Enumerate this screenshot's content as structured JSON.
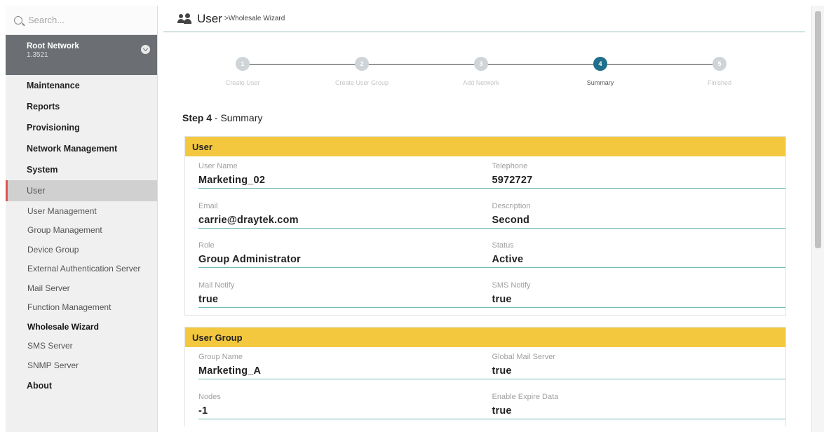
{
  "sidebar": {
    "search_placeholder": "Search...",
    "root_network": {
      "name": "Root Network",
      "count": "1.3521"
    },
    "menu_top": [
      "Maintenance",
      "Reports",
      "Provisioning",
      "Network Management",
      "System"
    ],
    "active_menu": "User",
    "submenu": [
      "User Management",
      "Group Management",
      "Device Group",
      "External Authentication Server",
      "Mail Server",
      "Function Management",
      "Wholesale Wizard",
      "SMS Server",
      "SNMP Server"
    ],
    "current_sub": "Wholesale Wizard",
    "menu_bottom": [
      "About"
    ]
  },
  "header": {
    "title": "User",
    "breadcrumb": ">Wholesale Wizard"
  },
  "wizard": {
    "steps": [
      {
        "number": "1",
        "label": "Create User"
      },
      {
        "number": "2",
        "label": "Create User Group"
      },
      {
        "number": "3",
        "label": "Add Network"
      },
      {
        "number": "4",
        "label": "Summary"
      },
      {
        "number": "5",
        "label": "Finished"
      }
    ],
    "current_step": 4
  },
  "step_heading": {
    "prefix": "Step 4",
    "suffix": " - Summary"
  },
  "user_section": {
    "title": "User",
    "fields": [
      {
        "label": "User Name",
        "value": "Marketing_02"
      },
      {
        "label": "Telephone",
        "value": "5972727"
      },
      {
        "label": "Email",
        "value": "carrie@draytek.com"
      },
      {
        "label": "Description",
        "value": "Second"
      },
      {
        "label": "Role",
        "value": "Group Administrator"
      },
      {
        "label": "Status",
        "value": "Active"
      },
      {
        "label": "Mail Notify",
        "value": "true"
      },
      {
        "label": "SMS Notify",
        "value": "true"
      }
    ]
  },
  "group_section": {
    "title": "User Group",
    "fields": [
      {
        "label": "Group Name",
        "value": "Marketing_A"
      },
      {
        "label": "Global Mail Server",
        "value": "true"
      },
      {
        "label": "Nodes",
        "value": "-1"
      },
      {
        "label": "Enable Expire Data",
        "value": "true"
      }
    ]
  },
  "colors": {
    "accent_yellow": "#f3c83f",
    "wizard_active": "#1e6e8c",
    "underline": "#6fbab3",
    "active_border": "#e4514e"
  }
}
